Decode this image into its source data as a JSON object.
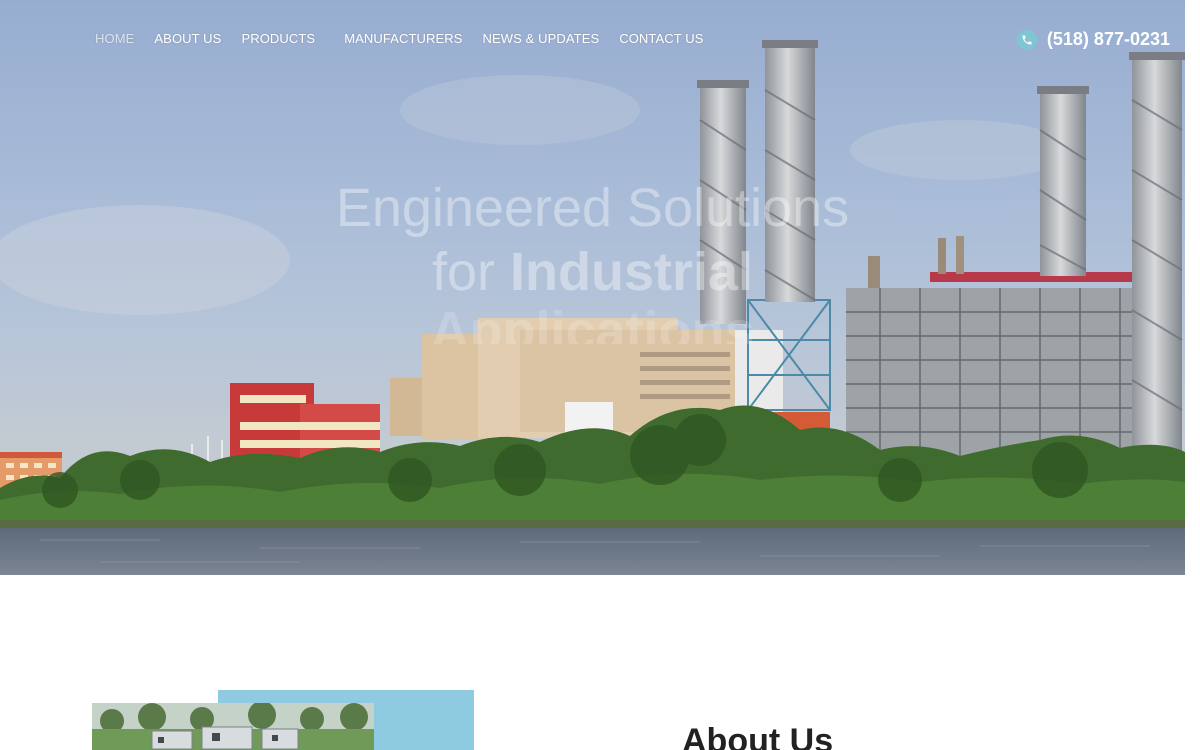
{
  "nav": {
    "items": [
      "HOME",
      "ABOUT US",
      "PRODUCTS",
      "MANUFACTURERS",
      "NEWS & UPDATES",
      "CONTACT US"
    ],
    "active": "HOME"
  },
  "contact": {
    "phone": "(518) 877-0231",
    "icon": "phone-icon",
    "icon_color": "#7dc6d2"
  },
  "hero": {
    "title_line1": "Engineered Solutions",
    "title_line2_prefix": "for ",
    "title_line2_bold": "Industrial",
    "title_line3": "Applications"
  },
  "about": {
    "heading_prefix": "About ",
    "heading_bold": "Us"
  },
  "colors": {
    "accent": "#7dc6d2",
    "about_image_backdrop": "#8fcbe0",
    "heading_text": "#222222"
  }
}
